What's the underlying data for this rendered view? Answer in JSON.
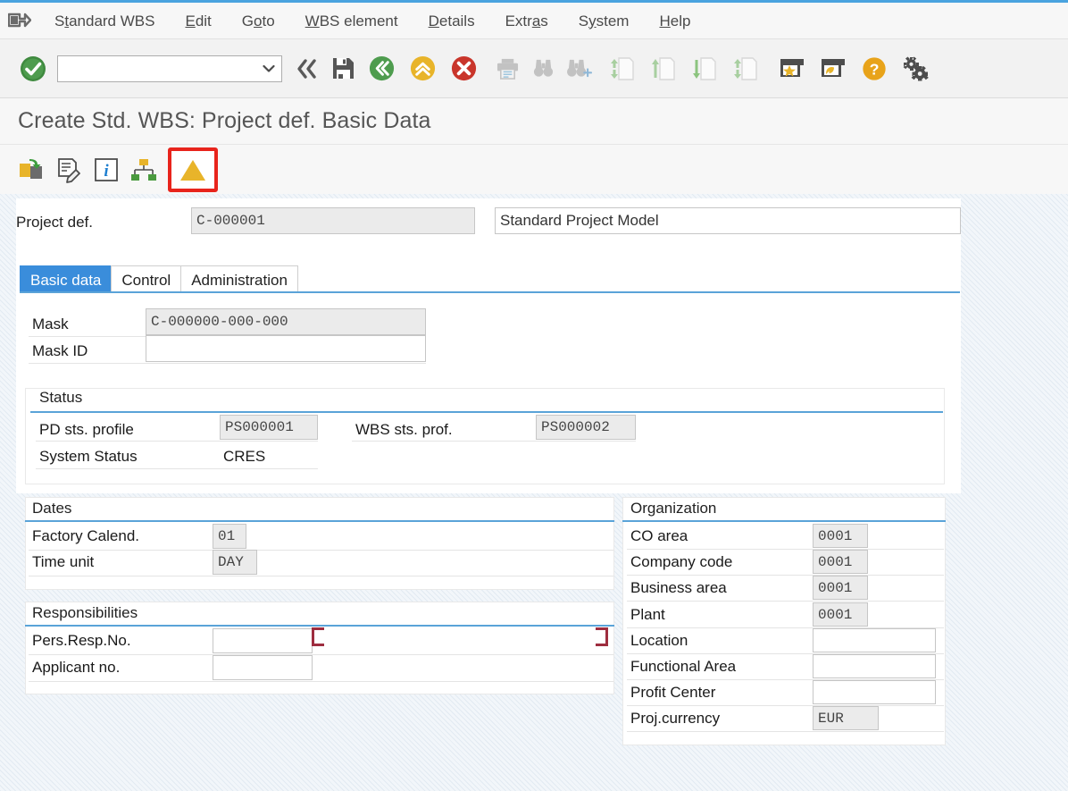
{
  "menubar": {
    "system_icon": "sap-logo-icon",
    "items": [
      {
        "label": "Standard WBS",
        "mnemonic_index": 1
      },
      {
        "label": "Edit",
        "mnemonic_index": 0
      },
      {
        "label": "Goto",
        "mnemonic_index": 1
      },
      {
        "label": "WBS element",
        "mnemonic_index": 0
      },
      {
        "label": "Details",
        "mnemonic_index": 0
      },
      {
        "label": "Extras",
        "mnemonic_index": 4
      },
      {
        "label": "System",
        "mnemonic_index": 1
      },
      {
        "label": "Help",
        "mnemonic_index": 0
      }
    ]
  },
  "system_toolbar": {
    "enter_button_name": "enter-check-button",
    "command_field": {
      "value": "",
      "placeholder": ""
    },
    "buttons": [
      {
        "name": "previous-chevrons-button",
        "icon": "double-chevron-left-icon"
      },
      {
        "name": "save-button",
        "icon": "save-floppy-icon"
      },
      {
        "name": "back-button",
        "icon": "green-back-icon"
      },
      {
        "name": "exit-button",
        "icon": "yellow-up-icon"
      },
      {
        "name": "cancel-button",
        "icon": "red-cancel-icon"
      },
      {
        "name": "print-button",
        "icon": "printer-icon"
      },
      {
        "name": "find-button",
        "icon": "binoculars-icon"
      },
      {
        "name": "find-next-button",
        "icon": "binoculars-plus-icon"
      },
      {
        "name": "first-page-button",
        "icon": "first-page-icon"
      },
      {
        "name": "previous-page-button",
        "icon": "previous-page-icon"
      },
      {
        "name": "next-page-button",
        "icon": "next-page-icon"
      },
      {
        "name": "last-page-button",
        "icon": "last-page-icon"
      },
      {
        "name": "create-shortcut-button",
        "icon": "window-star-icon"
      },
      {
        "name": "create-session-button",
        "icon": "window-arrow-icon"
      },
      {
        "name": "help-button",
        "icon": "help-question-icon"
      },
      {
        "name": "customize-layout-button",
        "icon": "gear-icon"
      }
    ]
  },
  "title": "Create Std. WBS: Project def. Basic Data",
  "app_toolbar": {
    "buttons": [
      {
        "name": "copy-model-button",
        "icon": "copy-transfer-icon",
        "highlighted": false
      },
      {
        "name": "edit-document-button",
        "icon": "document-pencil-icon",
        "highlighted": false
      },
      {
        "name": "info-button",
        "icon": "info-i-icon",
        "highlighted": false
      },
      {
        "name": "hierarchy-button",
        "icon": "org-hierarchy-icon",
        "highlighted": false
      },
      {
        "name": "warning-triangle-button",
        "icon": "yellow-triangle-icon",
        "highlighted": true
      }
    ],
    "highlight_color": "#e8241c"
  },
  "header": {
    "project_def_label": "Project def.",
    "project_def_value": "C-000001",
    "project_description": "Standard Project Model"
  },
  "tabs": [
    {
      "label": "Basic data",
      "active": true
    },
    {
      "label": "Control",
      "active": false
    },
    {
      "label": "Administration",
      "active": false
    }
  ],
  "mask_section": {
    "rows": [
      {
        "label": "Mask",
        "value": "C-000000-000-000",
        "readonly": true
      },
      {
        "label": "Mask ID",
        "value": "",
        "readonly": false
      }
    ]
  },
  "status_group": {
    "title": "Status",
    "pd_status_profile_label": "PD sts. profile",
    "pd_status_profile_value": "PS000001",
    "wbs_status_profile_label": "WBS sts. prof.",
    "wbs_status_profile_value": "PS000002",
    "system_status_label": "System Status",
    "system_status_value": "CRES"
  },
  "dates_group": {
    "title": "Dates",
    "rows": [
      {
        "label": "Factory Calend.",
        "value": "01"
      },
      {
        "label": "Time unit",
        "value": "DAY"
      }
    ]
  },
  "responsibilities_group": {
    "title": "Responsibilities",
    "rows": [
      {
        "label": "Pers.Resp.No.",
        "value": ""
      },
      {
        "label": "Applicant no.",
        "value": ""
      }
    ]
  },
  "organization_group": {
    "title": "Organization",
    "rows": [
      {
        "label": "CO area",
        "value": "0001",
        "short": true
      },
      {
        "label": "Company code",
        "value": "0001",
        "short": true
      },
      {
        "label": "Business area",
        "value": "0001",
        "short": true
      },
      {
        "label": "Plant",
        "value": "0001",
        "short": true
      },
      {
        "label": "Location",
        "value": "",
        "short": false
      },
      {
        "label": "Functional Area",
        "value": "",
        "short": false
      },
      {
        "label": "Profit Center",
        "value": "",
        "short": false
      },
      {
        "label": "Proj.currency",
        "value": "EUR",
        "short": true
      }
    ]
  },
  "colors": {
    "accent_blue": "#5aa3d8",
    "tab_active": "#3a8ddb",
    "highlight_red": "#e8241c",
    "cropmark_red": "#9e2d3f",
    "readonly_field": "#ebebeb"
  }
}
